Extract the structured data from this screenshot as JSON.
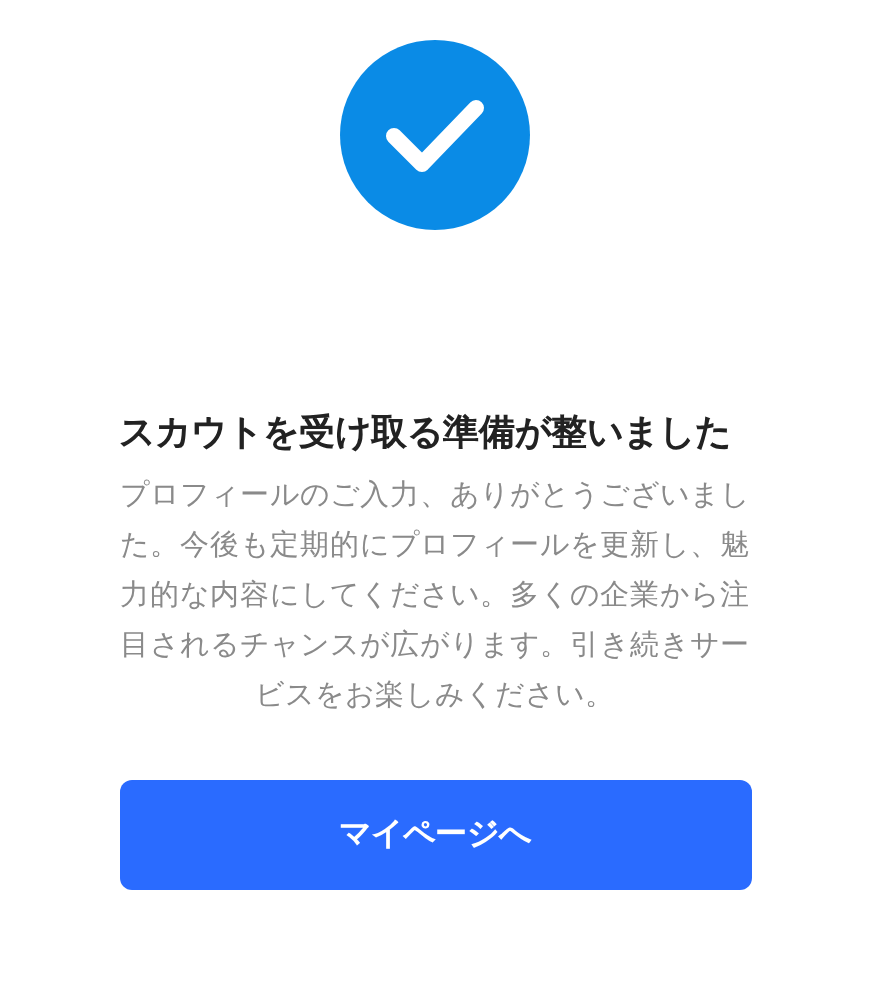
{
  "status": {
    "kind": "success"
  },
  "title": "スカウトを受け取る準備が整いました",
  "message": "プロフィールのご入力、ありがとうございました。今後も定期的にプロフィールを更新し、魅力的な内容にしてください。多くの企業から注目されるチャンスが広がります。引き続きサービスをお楽しみください。",
  "button": "マイページへ"
}
